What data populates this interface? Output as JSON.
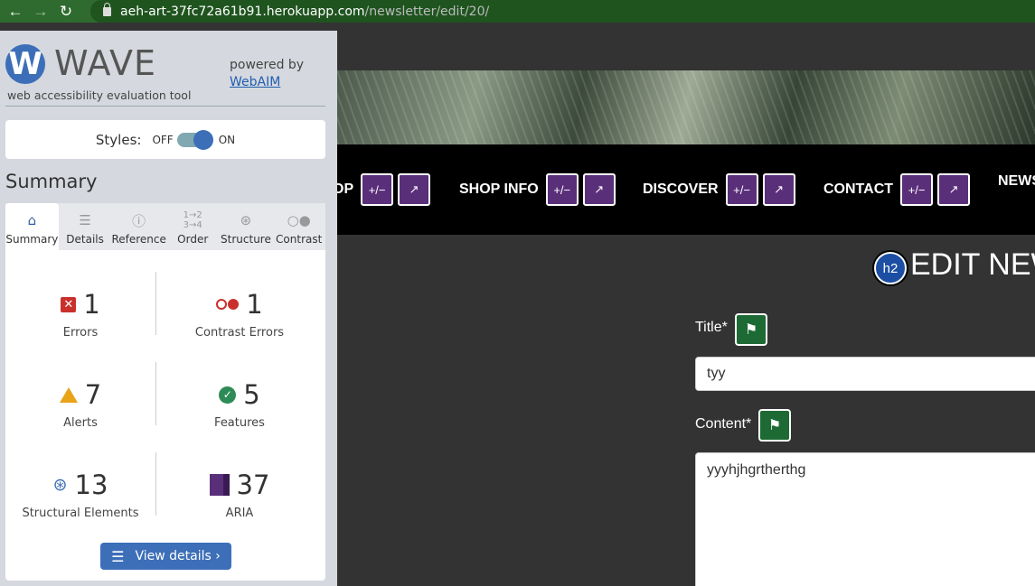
{
  "browser": {
    "url_host": "aeh-art-37fc72a61b91.herokuapp.com",
    "url_path": "/newsletter/edit/20/"
  },
  "wave": {
    "title": "WAVE",
    "logo_letter": "W",
    "subtitle": "web accessibility evaluation tool",
    "powered_by": "powered by",
    "webaim_link": "WebAIM",
    "styles_label": "Styles:",
    "toggle_off": "OFF",
    "toggle_on": "ON",
    "summary_heading": "Summary",
    "tabs": [
      {
        "label": "Summary",
        "icon": "home-icon"
      },
      {
        "label": "Details",
        "icon": "list-icon"
      },
      {
        "label": "Reference",
        "icon": "info-icon"
      },
      {
        "label": "Order",
        "icon": "order-icon"
      },
      {
        "label": "Structure",
        "icon": "structure-icon"
      },
      {
        "label": "Contrast",
        "icon": "contrast-icon"
      }
    ],
    "stats": {
      "errors": {
        "count": "1",
        "label": "Errors"
      },
      "contrast_errors": {
        "count": "1",
        "label": "Contrast Errors"
      },
      "alerts": {
        "count": "7",
        "label": "Alerts"
      },
      "features": {
        "count": "5",
        "label": "Features"
      },
      "structural": {
        "count": "13",
        "label": "Structural Elements"
      },
      "aria": {
        "count": "37",
        "label": "ARIA"
      }
    },
    "view_details": "View details ›"
  },
  "page": {
    "nav": [
      {
        "label": "OP"
      },
      {
        "label": "SHOP INFO"
      },
      {
        "label": "DISCOVER"
      },
      {
        "label": "CONTACT"
      },
      {
        "label": "NEWS"
      }
    ],
    "aria_plus_minus": "+/−",
    "aria_arrow": "↗",
    "h2_badge": "h2",
    "heading": "EDIT NEW",
    "title_label": "Title*",
    "title_value": "tyy",
    "content_label": "Content*",
    "content_value": "yyyhjhgrtherthg"
  },
  "colors": {
    "browser_green": "#2f6b2f",
    "wave_blue": "#3d6fb8",
    "error_red": "#c9302c",
    "alert_orange": "#e8a317",
    "feature_green": "#2e8b57",
    "aria_purple": "#5a2f7a"
  }
}
